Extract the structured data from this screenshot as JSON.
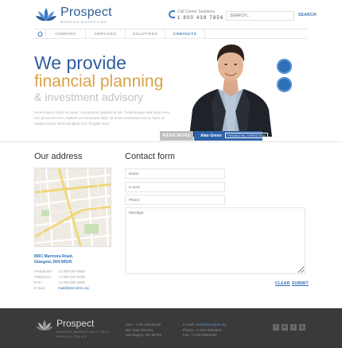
{
  "header": {
    "logo_title": "Prospect",
    "logo_sub": "MODERN MARKETING",
    "phone_label": "Call Center Solutions",
    "phone_number": "1 800 438 7856",
    "search_placeholder": "SEARCH...",
    "search_button": "SEARCH"
  },
  "nav": {
    "items": [
      "COMPANY",
      "SERVICES",
      "SOLUTIONS",
      "CONTACTS"
    ],
    "active": "CONTACTS"
  },
  "hero": {
    "line1": "We provide",
    "line2": "financial planning",
    "line3": "& investment advisory",
    "paragraph": "Lorem ipsum dolor sit amet, consectetur adipiscing elit. Pellentesque sed dolor eros, nec placerat lorem. Nullam at consequat nibh, sit amet vestibulum lacus. Nam ac magna luctus vehicula ligula nec, fringilla nunc.",
    "readmore": "READ MORE",
    "person_name": "Alan Green",
    "person_role": "FINANCIAL DIRECTOR"
  },
  "address": {
    "title": "Our address",
    "street": "8901 Marmora Road,",
    "city": "Glasgow, D04 89GR.",
    "rows": [
      {
        "k": "Freephone:",
        "v": "+1 800 559 6580"
      },
      {
        "k": "Telephone:",
        "v": "+1 800 603 6035"
      },
      {
        "k": "FAX:",
        "v": "+1 800 889 9898"
      },
      {
        "k": "E-mail:",
        "v": "mail@demolink.org"
      }
    ]
  },
  "contact": {
    "title": "Contact form",
    "name_placeholder": "Name:",
    "email_placeholder": "E-mail:",
    "phone_placeholder": "Phone:",
    "message_placeholder": "Message:",
    "clear": "CLEAR",
    "submit": "SUBMIT"
  },
  "footer": {
    "logo_title": "Prospect",
    "copyright": "MODERN MARKETING © 2012",
    "privacy": "PRIVACY POLICY",
    "addr1": "USA - LOS ANGELES",
    "addr2": "907 East 33 Feet",
    "addr3": "Wilmington, DC 90784",
    "email_label": "E-mail:",
    "email": "mail@demolink.org",
    "phone": "Phone: +1 910 8064652",
    "fax": "Fax: +1 910 8064652",
    "social": [
      "f",
      "in",
      "t",
      "g"
    ]
  },
  "colors": {
    "brand_blue": "#2f62a8",
    "accent_gold": "#d9a34a",
    "footer_bg": "#3a3a3a"
  }
}
